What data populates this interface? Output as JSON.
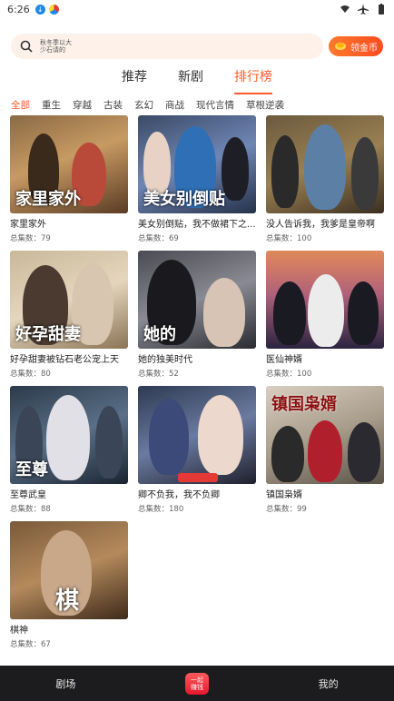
{
  "status_bar": {
    "time": "6:26"
  },
  "search": {
    "text": "秋冬季以大\n少石请的"
  },
  "coin_button": {
    "label": "领金币"
  },
  "main_tabs": [
    {
      "label": "推荐"
    },
    {
      "label": "新剧"
    },
    {
      "label": "排行榜"
    }
  ],
  "genre_tabs": [
    {
      "label": "全部"
    },
    {
      "label": "重生"
    },
    {
      "label": "穿越"
    },
    {
      "label": "古装"
    },
    {
      "label": "玄幻"
    },
    {
      "label": "商战"
    },
    {
      "label": "现代言情"
    },
    {
      "label": "草根逆袭"
    }
  ],
  "dramas": [
    {
      "title": "家里家外",
      "count": "总集数：79",
      "overlay": "家里家外"
    },
    {
      "title": "美女别倒贴，我不做裙下之...",
      "count": "总集数：69",
      "overlay": "美女别倒贴"
    },
    {
      "title": "没人告诉我，我爹是皇帝啊",
      "count": "总集数：100",
      "overlay": ""
    },
    {
      "title": "好孕甜妻被钻石老公宠上天",
      "count": "总集数：80",
      "overlay": "好孕甜妻"
    },
    {
      "title": "她的独美时代",
      "count": "总集数：52",
      "overlay": "她的"
    },
    {
      "title": "医仙神婿",
      "count": "总集数：100",
      "overlay": ""
    },
    {
      "title": "至尊武皇",
      "count": "总集数：88",
      "overlay": "至尊"
    },
    {
      "title": "卿不负我，我不负卿",
      "count": "总集数：180",
      "overlay": ""
    },
    {
      "title": "镇国枭婿",
      "count": "总集数：99",
      "overlay": "镇国枭婿"
    },
    {
      "title": "棋神",
      "count": "总集数：67",
      "overlay": "棋"
    }
  ],
  "bottom_nav": [
    {
      "label": "剧场"
    },
    {
      "label": "一起\n赚钱"
    },
    {
      "label": "我的"
    }
  ],
  "colors": {
    "accent": "#ff5b2a",
    "nav_bg": "#1c1c1e",
    "search_bg": "#fdf1ea"
  }
}
